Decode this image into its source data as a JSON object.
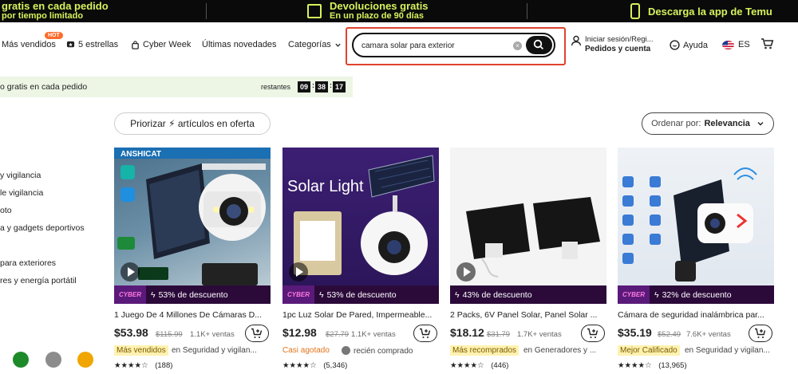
{
  "promo": {
    "left_line1": "gratis en cada pedido",
    "left_line2": "por tiempo limitado",
    "mid_line1": "Devoluciones gratis",
    "mid_line2": "En un plazo de 90 días",
    "right": "Descarga la app de Temu",
    "accent": "#d6f25d"
  },
  "nav": {
    "items": [
      "Más vendidos",
      "5 estrellas",
      "Cyber Week",
      "Últimas novedades",
      "Categorías"
    ],
    "hot_badge": "HOT",
    "search_value": "camara solar para exterior",
    "account_line1": "Iniciar sesión/Regi...",
    "account_line2": "Pedidos y cuenta",
    "help": "Ayuda",
    "lang": "ES"
  },
  "timer": {
    "message": "o gratis en cada pedido",
    "remaining_label": "restantes",
    "hh": "09",
    "mm": "38",
    "ss": "17"
  },
  "sidebar": [
    "y vigilancia",
    "le vigilancia",
    "oto",
    "a y gadgets deportivos",
    "para exteriores",
    "res y energía portátil"
  ],
  "filters": {
    "prioritize": "Priorizar ⚡ artículos en oferta",
    "sort_prefix": "Ordenar por:",
    "sort_value": "Relevancia"
  },
  "products": [
    {
      "discount": "53% de descuento",
      "title": "1 Juego De 4 Millones De Cámaras D...",
      "price": "$53.98",
      "old_price": "$115.99",
      "sales": "1.1K+ ventas",
      "badge": "Más vendidos",
      "badge_context": "en Seguridad y vigilan...",
      "rating": "★★★★☆",
      "reviews": "(188)"
    },
    {
      "discount": "53% de descuento",
      "title": "1pc Luz Solar De Pared, Impermeable...",
      "price": "$12.98",
      "old_price": "$27.79",
      "sales": "1.1K+ ventas",
      "badge": "Casi agotado",
      "badge_context": "recién comprado",
      "rating": "★★★★☆",
      "reviews": "(5,346)",
      "image_text": "Solar Light"
    },
    {
      "discount": "43% de descuento",
      "title": "2 Packs, 6V Panel Solar, Panel Solar ...",
      "price": "$18.12",
      "old_price": "$31.79",
      "sales": "1.7K+ ventas",
      "badge": "Más recomprados",
      "badge_context": "en Generadores y ...",
      "rating": "★★★★☆",
      "reviews": "(446)"
    },
    {
      "discount": "32% de descuento",
      "title": "Cámara de seguridad inalámbrica par...",
      "price": "$35.19",
      "old_price": "$52.49",
      "sales": "7.6K+ ventas",
      "badge": "Mejor Calificado",
      "badge_context": "en Seguridad y vigilan...",
      "rating": "★★★★☆",
      "reviews": "(13,965)"
    }
  ],
  "cyber_tag": "CYBER",
  "brand_label": "ANSHICAT"
}
